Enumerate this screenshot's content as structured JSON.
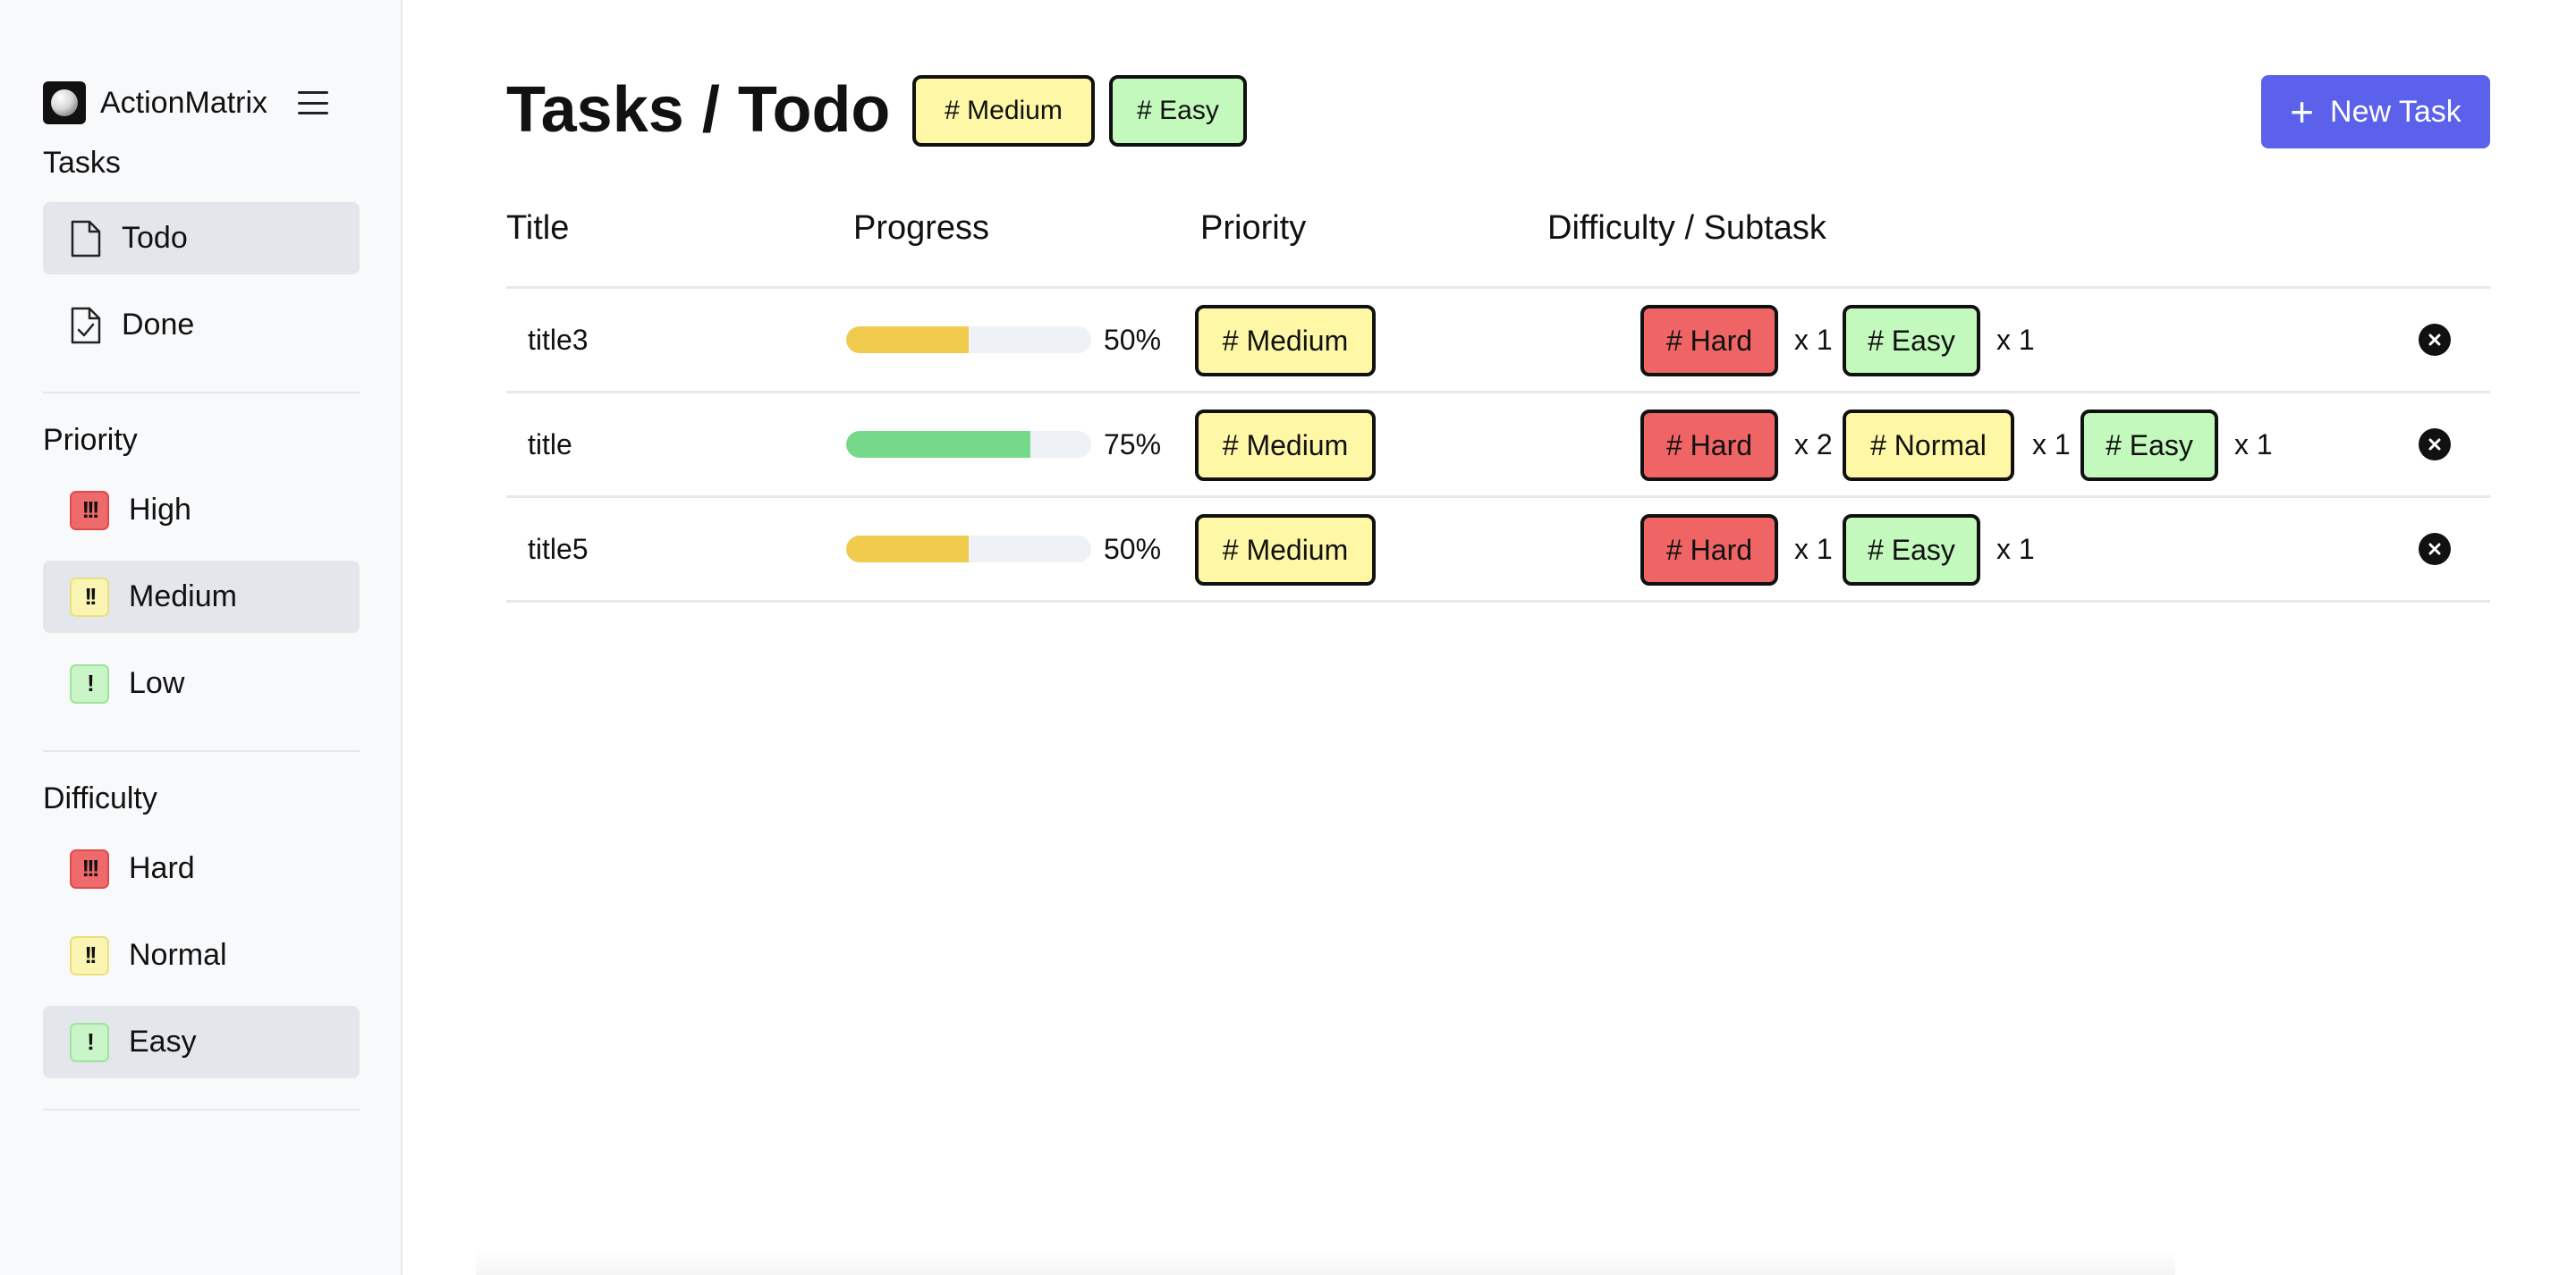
{
  "app": {
    "name": "ActionMatrix"
  },
  "sidebar": {
    "tasks_label": "Tasks",
    "tasks": [
      {
        "label": "Todo",
        "icon": "document-icon",
        "selected": true
      },
      {
        "label": "Done",
        "icon": "document-check-icon",
        "selected": false
      }
    ],
    "priority_label": "Priority",
    "priority": [
      {
        "label": "High",
        "glyph": "!!!",
        "selected": false
      },
      {
        "label": "Medium",
        "glyph": "!!",
        "selected": true
      },
      {
        "label": "Low",
        "glyph": "!",
        "selected": false
      }
    ],
    "difficulty_label": "Difficulty",
    "difficulty": [
      {
        "label": "Hard",
        "glyph": "!!!",
        "selected": false
      },
      {
        "label": "Normal",
        "glyph": "!!",
        "selected": false
      },
      {
        "label": "Easy",
        "glyph": "!",
        "selected": true
      }
    ]
  },
  "header": {
    "title": "Tasks / Todo",
    "filters": [
      "# Medium",
      "# Easy"
    ],
    "new_task_label": "New Task"
  },
  "table": {
    "columns": [
      "Title",
      "Progress",
      "Priority",
      "Difficulty / Subtask"
    ],
    "rows": [
      {
        "title": "title3",
        "progress_pct": 50,
        "progress_label": "50%",
        "progress_color": "#f1cb4d",
        "priority": "# Medium",
        "subtasks": [
          {
            "tag": "# Hard",
            "count": "x 1"
          },
          {
            "tag": "# Easy",
            "count": "x 1"
          }
        ]
      },
      {
        "title": "title",
        "progress_pct": 75,
        "progress_label": "75%",
        "progress_color": "#76d98a",
        "priority": "# Medium",
        "subtasks": [
          {
            "tag": "# Hard",
            "count": "x 2"
          },
          {
            "tag": "# Normal",
            "count": "x 1"
          },
          {
            "tag": "# Easy",
            "count": "x 1"
          }
        ]
      },
      {
        "title": "title5",
        "progress_pct": 50,
        "progress_label": "50%",
        "progress_color": "#f1cb4d",
        "priority": "# Medium",
        "subtasks": [
          {
            "tag": "# Hard",
            "count": "x 1"
          },
          {
            "tag": "# Easy",
            "count": "x 1"
          }
        ]
      }
    ]
  },
  "colors": {
    "accent": "#5b61ea",
    "tag_hard": "#ef6464",
    "tag_normal": "#fdf7a6",
    "tag_easy": "#c3f9bd"
  }
}
